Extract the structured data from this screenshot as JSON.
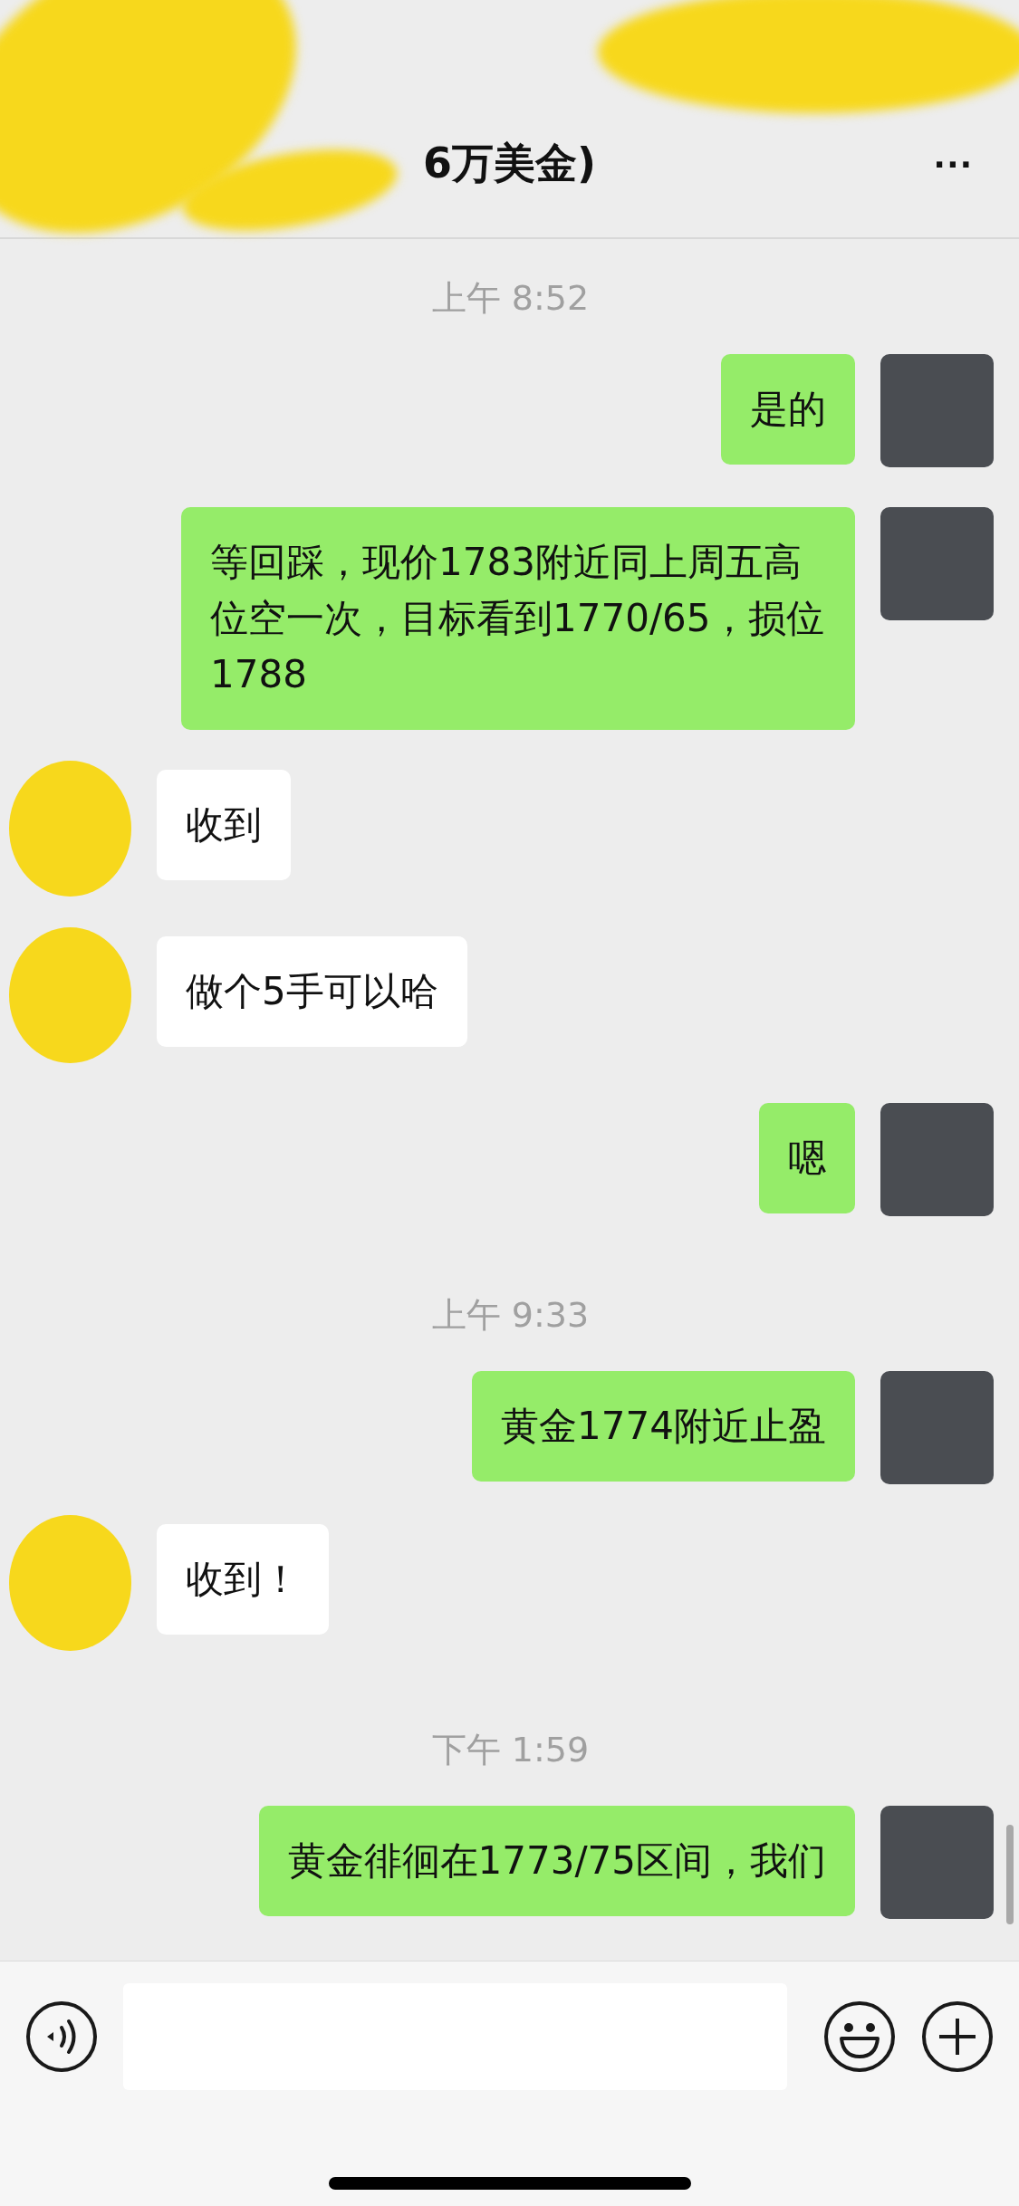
{
  "header": {
    "title": "6万美金)",
    "more": "···"
  },
  "messages": [
    {
      "kind": "time",
      "text": "上午 8:52"
    },
    {
      "kind": "sent",
      "text": "是的"
    },
    {
      "kind": "sent",
      "text": "等回踩，现价1783附近同上周五高位空一次，目标看到1770/65，损位1788"
    },
    {
      "kind": "received",
      "text": "收到"
    },
    {
      "kind": "received",
      "text": "做个5手可以哈"
    },
    {
      "kind": "sent",
      "text": "嗯"
    },
    {
      "kind": "time",
      "text": "上午 9:33"
    },
    {
      "kind": "sent",
      "text": "黄金1774附近止盈"
    },
    {
      "kind": "received",
      "text": "收到！"
    },
    {
      "kind": "time",
      "text": "下午 1:59"
    },
    {
      "kind": "sent",
      "text": "黄金徘徊在1773/75区间，我们"
    }
  ]
}
